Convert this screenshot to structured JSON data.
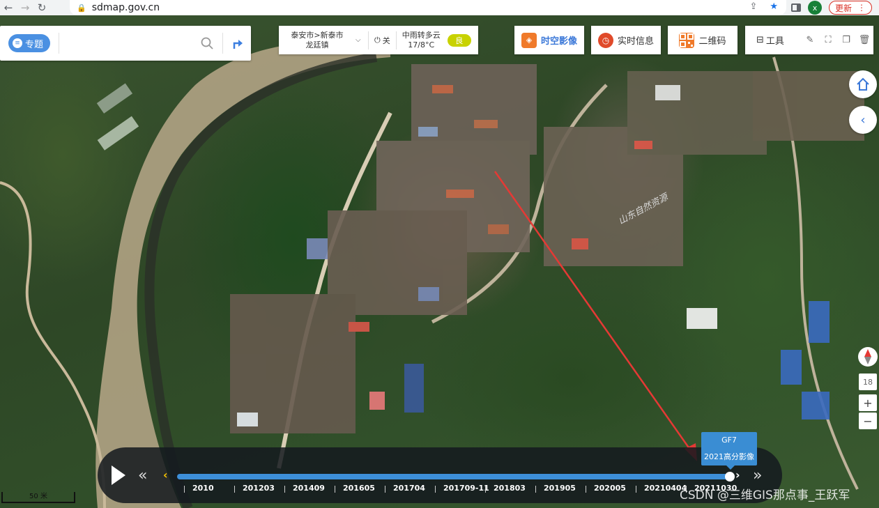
{
  "browser": {
    "url": "sdmap.gov.cn",
    "profile_initial": "x",
    "update_label": "更新"
  },
  "search": {
    "topic_label": "专题",
    "placeholder": ""
  },
  "location": {
    "line1": "泰安市>新泰市",
    "line2": "龙廷镇"
  },
  "power_label": "关",
  "weather": {
    "condition": "中雨转多云",
    "temp": "17/8°C",
    "aqi": "良"
  },
  "top_buttons": {
    "timespace": "时空影像",
    "realtime": "实时信息",
    "qrcode": "二维码"
  },
  "tools": {
    "label": "工具"
  },
  "zoom": {
    "level": "18",
    "plus": "+",
    "minus": "−"
  },
  "timeline": {
    "ticks": [
      "2010",
      "201203",
      "201409",
      "201605",
      "201704",
      "201709-11",
      "201803",
      "201905",
      "202005",
      "20210404",
      "20211030"
    ],
    "selected_index": 10,
    "tooltip_title": "GF7",
    "tooltip_subtitle": "2021高分影像"
  },
  "map_label": "山东自然资源",
  "scale_label": "50 米",
  "watermark": "CSDN @三维GIS那点事_王跃军",
  "colors": {
    "accent": "#3b78d8",
    "track": "#3d8fd8",
    "arrow": "#e53935",
    "aqi": "#c8d200"
  }
}
